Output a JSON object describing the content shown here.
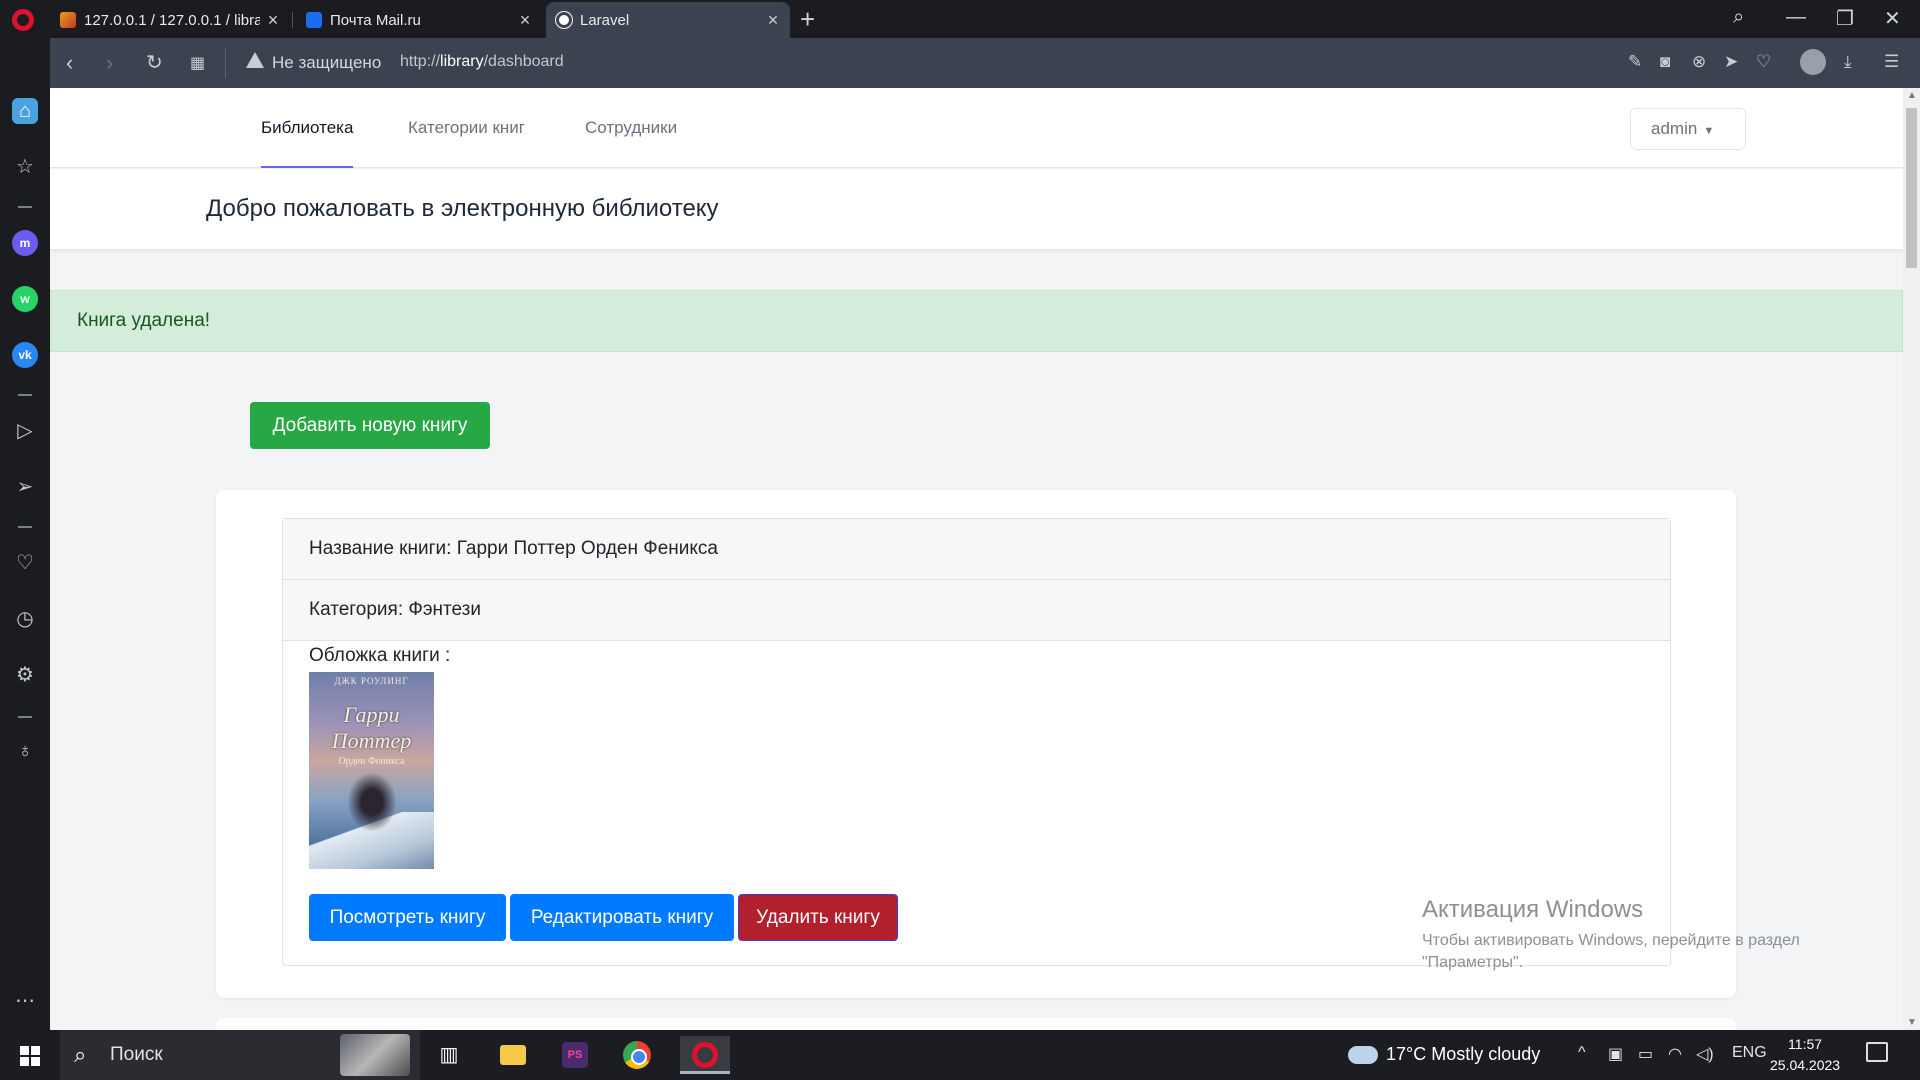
{
  "browser": {
    "tabs": [
      {
        "title": "127.0.0.1 / 127.0.0.1 / library",
        "icon": "database-icon"
      },
      {
        "title": "Почта Mail.ru",
        "icon": "mail-icon"
      },
      {
        "title": "Laravel",
        "icon": "globe-icon",
        "active": true
      }
    ],
    "security_label": "Не защищено",
    "url_prefix": "http://",
    "url_host": "library",
    "url_path": "/dashboard"
  },
  "nav": {
    "links": [
      "Библиотека",
      "Категории книг",
      "Сотрудники"
    ],
    "active": "Библиотека",
    "user": "admin"
  },
  "header": {
    "title": "Добро пожаловать в электронную библиотеку"
  },
  "alert": {
    "message": "Книга удалена!"
  },
  "actions": {
    "add_book": "Добавить новую книгу"
  },
  "book": {
    "title_line": "Название книги: Гарри Поттер Орден Феникса",
    "category_line": "Категория: Фэнтези",
    "cover_label": "Обложка книги :",
    "cover": {
      "author": "ДЖК РОУЛИНГ",
      "title": "Гарри Поттер",
      "subtitle": "Орден Феникса"
    },
    "buttons": {
      "view": "Посмотреть книгу",
      "edit": "Редактировать книгу",
      "delete": "Удалить книгу"
    }
  },
  "watermark": {
    "title": "Активация Windows",
    "text": "Чтобы активировать Windows, перейдите в раздел \"Параметры\"."
  },
  "taskbar": {
    "search_placeholder": "Поиск",
    "weather": "17°C  Mostly cloudy",
    "lang": "ENG",
    "time": "11:57",
    "date": "25.04.2023"
  },
  "colors": {
    "success_green": "#28a745",
    "primary_blue": "#007bff",
    "danger_red": "#b21f2d",
    "alert_bg": "#d4edda"
  }
}
